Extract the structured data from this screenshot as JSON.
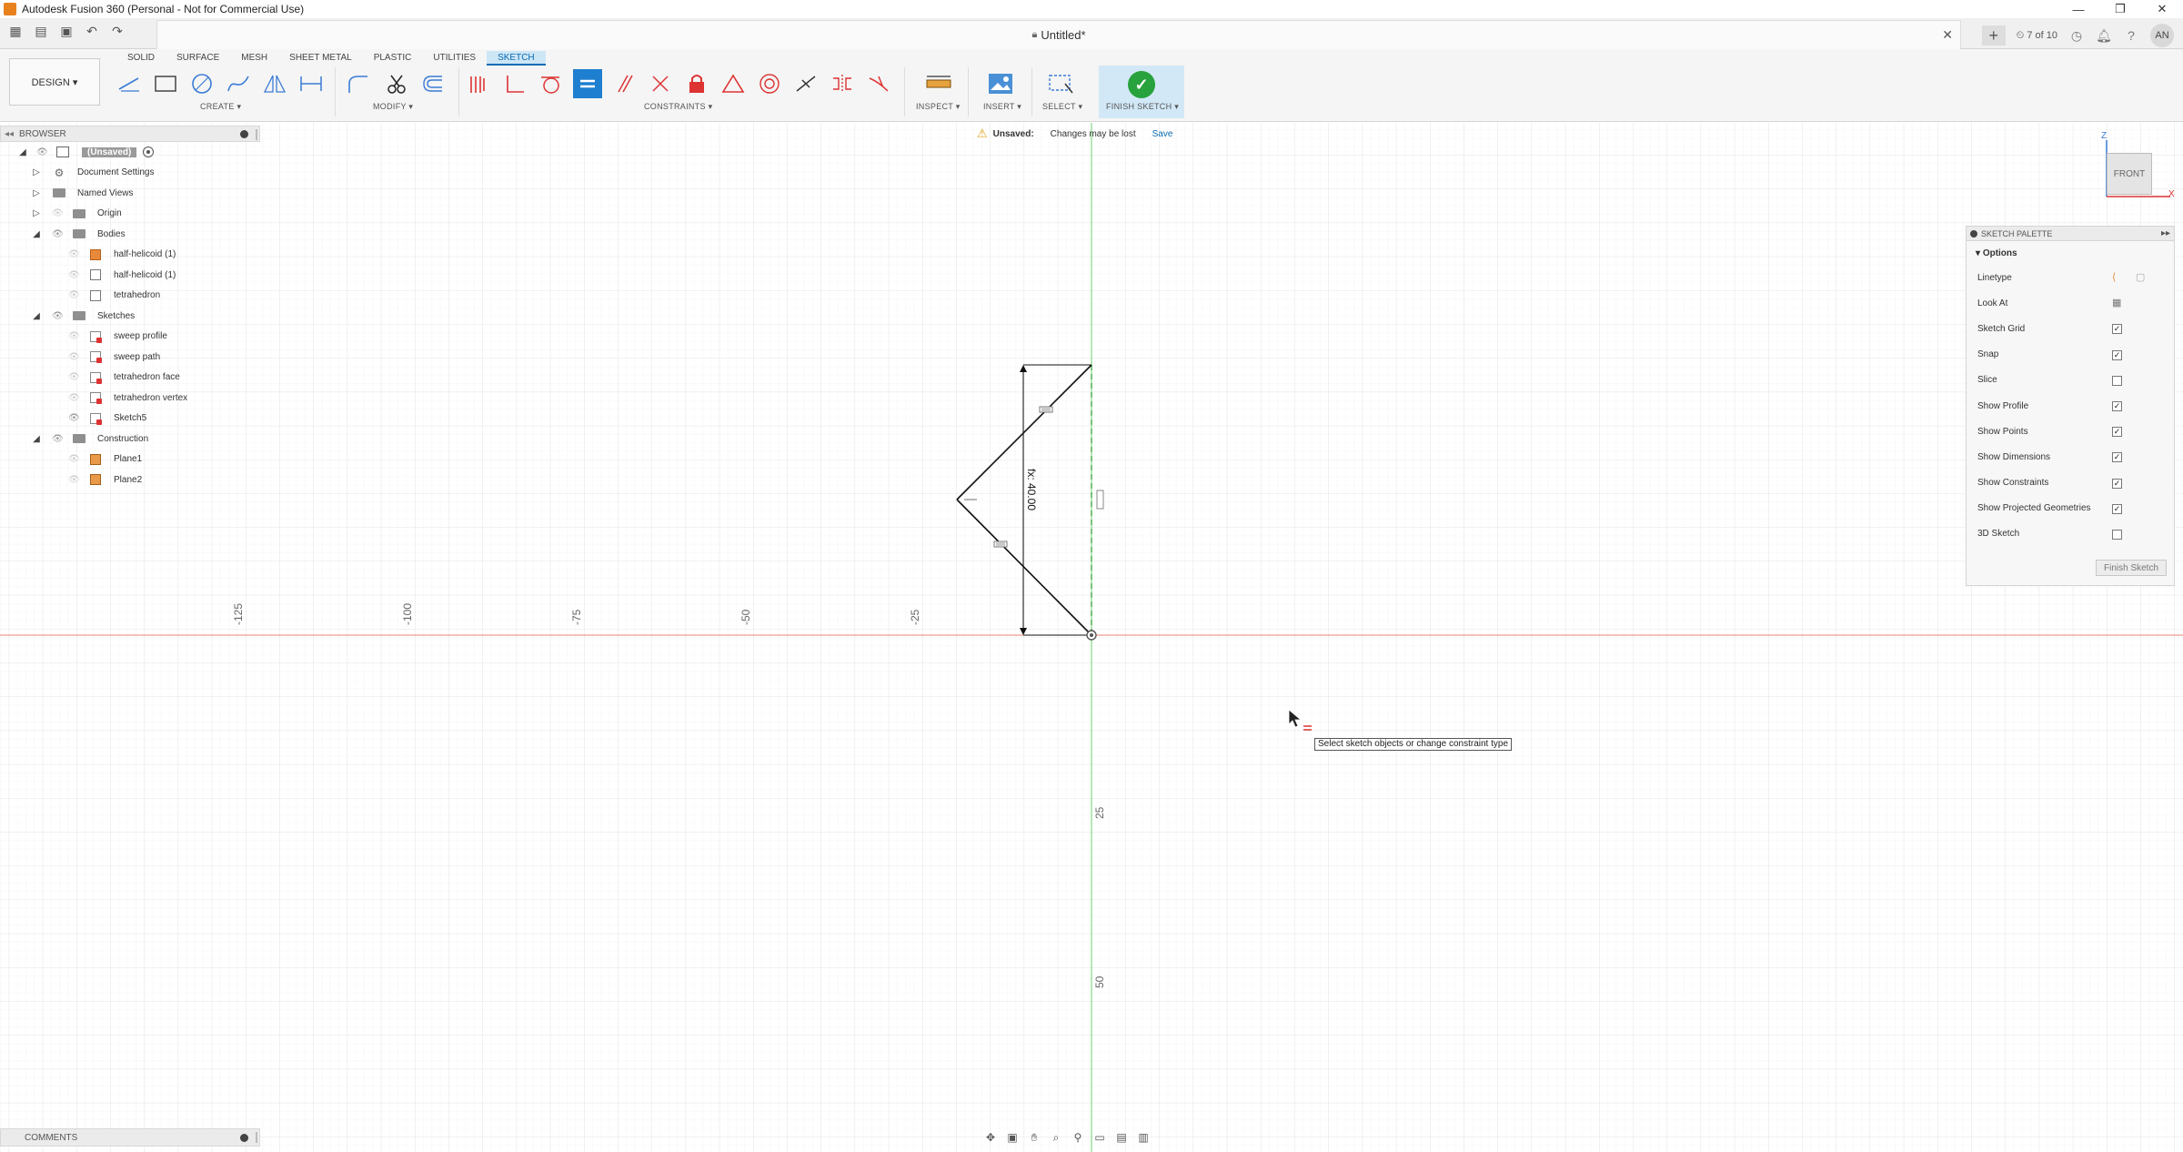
{
  "app": {
    "title": "Autodesk Fusion 360 (Personal - Not for Commercial Use)",
    "window_buttons": [
      "—",
      "❐",
      "✕"
    ]
  },
  "doc": {
    "name": "Untitled*",
    "jobs": "7 of 10",
    "avatar": "AN",
    "close": "✕"
  },
  "ribbon": {
    "workspace": "DESIGN ▾",
    "tabs": [
      "SOLID",
      "SURFACE",
      "MESH",
      "SHEET METAL",
      "PLASTIC",
      "UTILITIES",
      "SKETCH"
    ],
    "active_tab": "SKETCH",
    "groups": {
      "create": "CREATE ▾",
      "modify": "MODIFY ▾",
      "constraints": "CONSTRAINTS ▾",
      "inspect": "INSPECT ▾",
      "insert": "INSERT ▾",
      "select": "SELECT ▾",
      "finish": "FINISH SKETCH ▾"
    }
  },
  "browser": {
    "title": "BROWSER",
    "root": "(Unsaved)",
    "items": [
      {
        "label": "Document Settings"
      },
      {
        "label": "Named Views"
      },
      {
        "label": "Origin"
      },
      {
        "label": "Bodies"
      },
      {
        "label": "half-helicoid (1)"
      },
      {
        "label": "half-helicoid (1)"
      },
      {
        "label": "tetrahedron"
      },
      {
        "label": "Sketches"
      },
      {
        "label": "sweep profile"
      },
      {
        "label": "sweep path"
      },
      {
        "label": "tetrahedron face"
      },
      {
        "label": "tetrahedron vertex"
      },
      {
        "label": "Sketch5"
      },
      {
        "label": "Construction"
      },
      {
        "label": "Plane1"
      },
      {
        "label": "Plane2"
      }
    ]
  },
  "banner": {
    "label": "Unsaved:",
    "message": "Changes may be lost",
    "action": "Save"
  },
  "viewcube": {
    "face": "FRONT",
    "z": "Z",
    "x": "X"
  },
  "palette": {
    "title": "SKETCH PALETTE",
    "section": "Options",
    "rows": [
      {
        "label": "Linetype"
      },
      {
        "label": "Look At"
      },
      {
        "label": "Sketch Grid",
        "checked": true
      },
      {
        "label": "Snap",
        "checked": true
      },
      {
        "label": "Slice",
        "checked": false
      },
      {
        "label": "Show Profile",
        "checked": true
      },
      {
        "label": "Show Points",
        "checked": true
      },
      {
        "label": "Show Dimensions",
        "checked": true
      },
      {
        "label": "Show Constraints",
        "checked": true
      },
      {
        "label": "Show Projected Geometries",
        "checked": true
      },
      {
        "label": "3D Sketch",
        "checked": false
      }
    ],
    "finish_button": "Finish Sketch"
  },
  "canvas": {
    "axis_labels_x": [
      "-125",
      "-100",
      "-75",
      "-50",
      "-25"
    ],
    "axis_labels_y": [
      "25",
      "50"
    ],
    "dimension": "fx: 40.00"
  },
  "tooltip": "Select sketch objects or change constraint type",
  "comments": {
    "title": "COMMENTS"
  },
  "colors": {
    "accent": "#0a6bb3",
    "active_tab_bg": "#cde6f6",
    "finish_green": "#27a23c",
    "x_axis": "#e8846f",
    "y_axis": "#6fcf6f"
  }
}
